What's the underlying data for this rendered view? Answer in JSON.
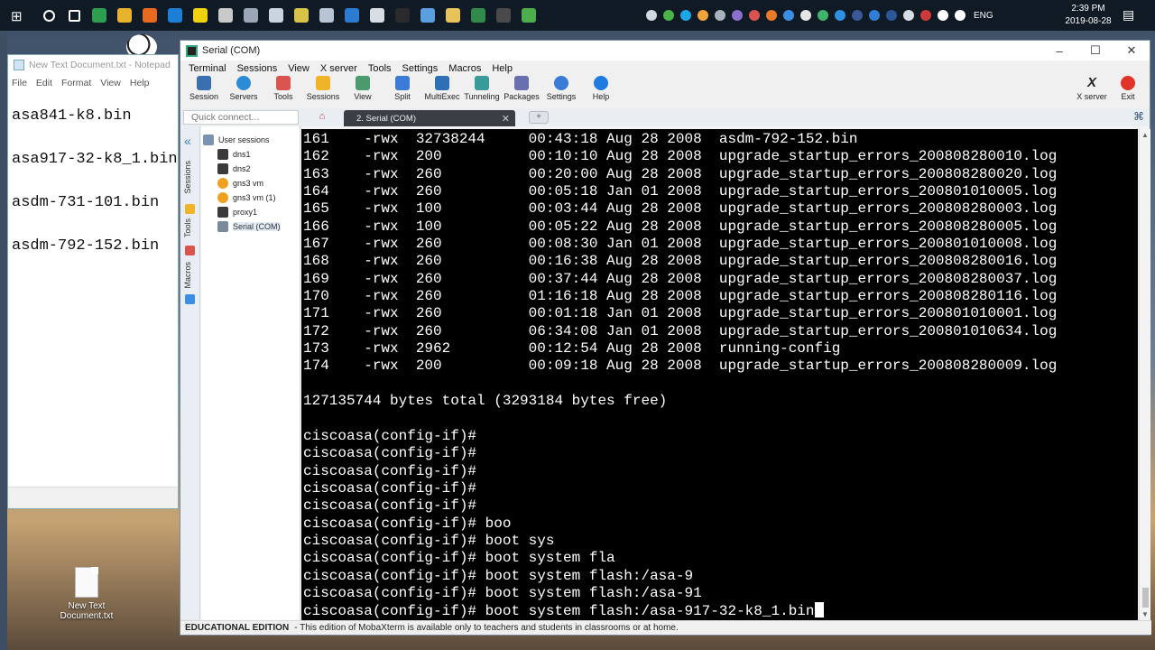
{
  "taskbar": {
    "start_icon": "windows-logo",
    "icons": [
      {
        "name": "cortana-icon",
        "color": "#ffffff"
      },
      {
        "name": "task-view-icon",
        "color": "#ffffff"
      },
      {
        "name": "app-green-icon",
        "color": "#2e9e4f"
      },
      {
        "name": "chrome-icon",
        "color": "#e8b32c"
      },
      {
        "name": "firefox-icon",
        "color": "#e66a1f"
      },
      {
        "name": "windows-explorer-blue-icon",
        "color": "#1b7fd6"
      },
      {
        "name": "sticky-note-icon",
        "color": "#f1d20e"
      },
      {
        "name": "network-tool-icon",
        "color": "#c9c9c9"
      },
      {
        "name": "documents-icon",
        "color": "#9aa7b8"
      },
      {
        "name": "send-icon",
        "color": "#c9d4e0"
      },
      {
        "name": "package-icon",
        "color": "#d8c34a"
      },
      {
        "name": "cube-icon",
        "color": "#b6c4d5"
      },
      {
        "name": "edge-icon",
        "color": "#2b7bd0"
      },
      {
        "name": "editor-icon",
        "color": "#d9dde3"
      },
      {
        "name": "terminal-icon",
        "color": "#2a2a2a"
      },
      {
        "name": "monitor-icon",
        "color": "#5aa0e0"
      },
      {
        "name": "folder-icon",
        "color": "#e8c25a"
      },
      {
        "name": "excel-icon",
        "color": "#2f8a4b"
      },
      {
        "name": "mobaxterm-icon",
        "color": "#4a4a4a"
      },
      {
        "name": "gns3-icon",
        "color": "#4cae4c"
      }
    ],
    "tray_icons": [
      {
        "name": "people-icon",
        "color": "#cfd8e0"
      },
      {
        "name": "tray-green-icon",
        "color": "#49b34a"
      },
      {
        "name": "skype-icon",
        "color": "#1ea5e6"
      },
      {
        "name": "tray-orange-icon",
        "color": "#f2a33a"
      },
      {
        "name": "tray-gray-icon",
        "color": "#a8b2bd"
      },
      {
        "name": "tray-purple-icon",
        "color": "#8a6fcf"
      },
      {
        "name": "tray-red-icon",
        "color": "#d9534f"
      },
      {
        "name": "tray-orange2-icon",
        "color": "#e87a2a"
      },
      {
        "name": "tray-blue-icon",
        "color": "#3a8ee6"
      },
      {
        "name": "tray-white-icon",
        "color": "#e6e6e6"
      },
      {
        "name": "tray-green2-icon",
        "color": "#3fb36b"
      },
      {
        "name": "tray-blue2-icon",
        "color": "#2f8fe0"
      },
      {
        "name": "facebook-icon",
        "color": "#3b5998"
      },
      {
        "name": "bluetooth-icon",
        "color": "#2f7ed8"
      },
      {
        "name": "word-icon",
        "color": "#2b5797"
      },
      {
        "name": "tray-white2-icon",
        "color": "#d6dde6"
      },
      {
        "name": "shield-icon",
        "color": "#cc3b3b"
      },
      {
        "name": "wifi-icon",
        "color": "#ffffff"
      },
      {
        "name": "volume-icon",
        "color": "#ffffff"
      }
    ],
    "language": "ENG",
    "time": "2:39 PM",
    "date": "2019-08-28"
  },
  "desktop": {
    "file_label": "New Text Document.txt"
  },
  "notepad": {
    "title": "New Text Document.txt - Notepad",
    "menu": [
      "File",
      "Edit",
      "Format",
      "View",
      "Help"
    ],
    "lines": [
      "asa841-k8.bin",
      "asa917-32-k8_1.bin",
      "asdm-731-101.bin",
      "asdm-792-152.bin"
    ]
  },
  "mobaxterm": {
    "title": "Serial (COM)",
    "menu": [
      "Terminal",
      "Sessions",
      "View",
      "X server",
      "Tools",
      "Settings",
      "Macros",
      "Help"
    ],
    "toolbar": [
      {
        "label": "Session",
        "icon": "session-icon",
        "color": "#3a6fb0"
      },
      {
        "label": "Servers",
        "icon": "servers-icon",
        "color": "#2d8bd5"
      },
      {
        "label": "Tools",
        "icon": "tools-icon",
        "color": "#d9534f"
      },
      {
        "label": "Sessions",
        "icon": "star-icon",
        "color": "#f0b429"
      },
      {
        "label": "View",
        "icon": "view-icon",
        "color": "#4a9a6b"
      },
      {
        "label": "Split",
        "icon": "split-icon",
        "color": "#3a7bd5"
      },
      {
        "label": "MultiExec",
        "icon": "multiexec-icon",
        "color": "#2f6fb5"
      },
      {
        "label": "Tunneling",
        "icon": "tunneling-icon",
        "color": "#3a9a9a"
      },
      {
        "label": "Packages",
        "icon": "packages-icon",
        "color": "#6a6fb0"
      },
      {
        "label": "Settings",
        "icon": "settings-icon",
        "color": "#3a7bd5"
      },
      {
        "label": "Help",
        "icon": "help-icon",
        "color": "#1e7be0"
      }
    ],
    "toolbar_right": [
      {
        "label": "X server",
        "icon": "xserver-icon",
        "color": "#222222"
      },
      {
        "label": "Exit",
        "icon": "power-icon",
        "color": "#e0342b"
      }
    ],
    "quick_connect_placeholder": "Quick connect...",
    "tab_label": "2. Serial (COM)",
    "sidebar_tabs": [
      "Sessions",
      "Tools",
      "Macros"
    ],
    "sessions_root": "User sessions",
    "sessions": [
      {
        "label": "dns1",
        "icon": "terminal-session-icon",
        "color": "#3a3a3a"
      },
      {
        "label": "dns2",
        "icon": "terminal-session-icon",
        "color": "#3a3a3a"
      },
      {
        "label": "gns3 vm",
        "icon": "gns3-session-icon",
        "color": "#f0a020"
      },
      {
        "label": "gns3 vm (1)",
        "icon": "gns3-session-icon",
        "color": "#f0a020"
      },
      {
        "label": "proxy1",
        "icon": "terminal-session-icon",
        "color": "#3a3a3a"
      },
      {
        "label": "Serial (COM)",
        "icon": "serial-session-icon",
        "color": "#7a8a9a"
      }
    ],
    "terminal_lines": [
      "161    -rwx  32738244     00:43:18 Aug 28 2008  asdm-792-152.bin",
      "162    -rwx  200          00:10:10 Aug 28 2008  upgrade_startup_errors_200808280010.log",
      "163    -rwx  260          00:20:00 Aug 28 2008  upgrade_startup_errors_200808280020.log",
      "164    -rwx  260          00:05:18 Jan 01 2008  upgrade_startup_errors_200801010005.log",
      "165    -rwx  100          00:03:44 Aug 28 2008  upgrade_startup_errors_200808280003.log",
      "166    -rwx  100          00:05:22 Aug 28 2008  upgrade_startup_errors_200808280005.log",
      "167    -rwx  260          00:08:30 Jan 01 2008  upgrade_startup_errors_200801010008.log",
      "168    -rwx  260          00:16:38 Aug 28 2008  upgrade_startup_errors_200808280016.log",
      "169    -rwx  260          00:37:44 Aug 28 2008  upgrade_startup_errors_200808280037.log",
      "170    -rwx  260          01:16:18 Aug 28 2008  upgrade_startup_errors_200808280116.log",
      "171    -rwx  260          00:01:18 Jan 01 2008  upgrade_startup_errors_200801010001.log",
      "172    -rwx  260          06:34:08 Jan 01 2008  upgrade_startup_errors_200801010634.log",
      "173    -rwx  2962         00:12:54 Aug 28 2008  running-config",
      "174    -rwx  200          00:09:18 Aug 28 2008  upgrade_startup_errors_200808280009.log",
      "",
      "127135744 bytes total (3293184 bytes free)",
      "",
      "ciscoasa(config-if)#",
      "ciscoasa(config-if)#",
      "ciscoasa(config-if)#",
      "ciscoasa(config-if)#",
      "ciscoasa(config-if)#",
      "ciscoasa(config-if)# boo",
      "ciscoasa(config-if)# boot sys",
      "ciscoasa(config-if)# boot system fla",
      "ciscoasa(config-if)# boot system flash:/asa-9",
      "ciscoasa(config-if)# boot system flash:/asa-91"
    ],
    "terminal_current_line": "ciscoasa(config-if)# boot system flash:/asa-917-32-k8_1.bin",
    "status_edition": "EDUCATIONAL EDITION",
    "status_text": " -  This edition of MobaXterm is available only to teachers and students in classrooms or at home."
  }
}
